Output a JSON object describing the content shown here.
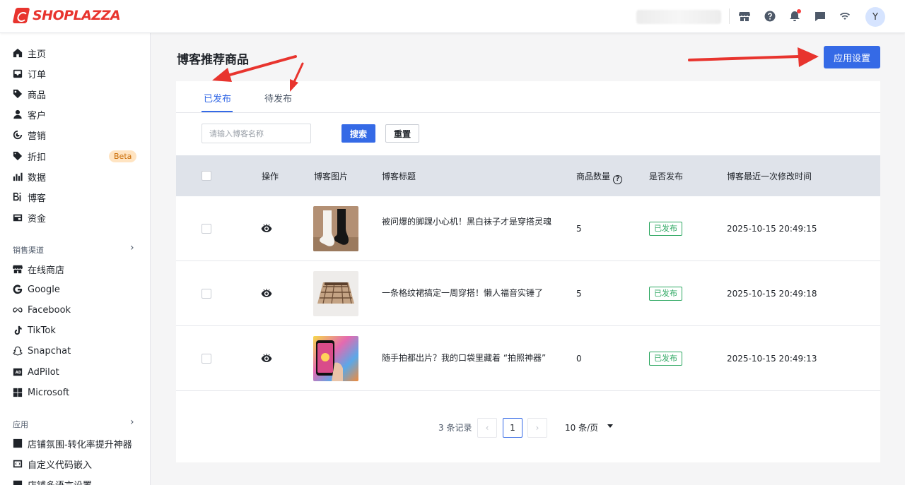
{
  "brand": {
    "name": "SHOPLAZZA",
    "color": "#e8342e"
  },
  "topbar": {
    "icons": [
      "store-icon",
      "help-icon",
      "bell-icon",
      "message-icon",
      "wifi-icon"
    ],
    "avatar_letter": "Y"
  },
  "sidebar": {
    "items": [
      {
        "label": "主页",
        "icon": "home-icon"
      },
      {
        "label": "订单",
        "icon": "inbox-icon"
      },
      {
        "label": "商品",
        "icon": "tag-icon"
      },
      {
        "label": "客户",
        "icon": "user-icon"
      },
      {
        "label": "营销",
        "icon": "target-icon"
      },
      {
        "label": "折扣",
        "icon": "discount-icon",
        "badge": "Beta"
      },
      {
        "label": "数据",
        "icon": "bar-chart-icon"
      },
      {
        "label": "博客",
        "icon": "blog-icon"
      },
      {
        "label": "资金",
        "icon": "wallet-icon"
      }
    ],
    "sales_channels_title": "销售渠道",
    "channels": [
      {
        "label": "在线商店",
        "icon": "store-icon"
      },
      {
        "label": "Google",
        "icon": "google-icon"
      },
      {
        "label": "Facebook",
        "icon": "meta-icon"
      },
      {
        "label": "TikTok",
        "icon": "tiktok-icon"
      },
      {
        "label": "Snapchat",
        "icon": "snapchat-icon"
      },
      {
        "label": "AdPilot",
        "icon": "adpilot-icon"
      },
      {
        "label": "Microsoft",
        "icon": "microsoft-icon"
      }
    ],
    "apps_title": "应用",
    "apps": [
      {
        "label": "店铺氛围-转化率提升神器",
        "icon": "app-icon"
      },
      {
        "label": "自定义代码嵌入",
        "icon": "code-icon"
      },
      {
        "label": "店铺多语言设置",
        "icon": "language-icon"
      }
    ]
  },
  "main": {
    "title": "博客推荐商品",
    "settings_button": "应用设置",
    "tabs": [
      {
        "label": "已发布",
        "active": true
      },
      {
        "label": "待发布",
        "active": false
      }
    ],
    "search": {
      "placeholder": "请输入博客名称",
      "search_label": "搜索",
      "reset_label": "重置"
    },
    "columns": [
      "操作",
      "博客图片",
      "博客标题",
      "商品数量",
      "是否发布",
      "博客最近一次修改时间"
    ],
    "rows": [
      {
        "title": "被问爆的脚踝小心机！黑白袜子才是穿搭灵魂",
        "count": "5",
        "status": "已发布",
        "modified": "2025-10-15 20:49:15",
        "image": "socks"
      },
      {
        "title": "一条格纹裙搞定一周穿搭！懒人福音实锤了",
        "count": "5",
        "status": "已发布",
        "modified": "2025-10-15 20:49:18",
        "image": "skirt"
      },
      {
        "title": "随手拍都出片？我的口袋里藏着 “拍照神器”",
        "count": "0",
        "status": "已发布",
        "modified": "2025-10-15 20:49:13",
        "image": "phone"
      }
    ],
    "pagination": {
      "total_text": "3 条记录",
      "prev": "‹",
      "current": "1",
      "next": "›",
      "page_size": "10 条/页"
    }
  },
  "colors": {
    "primary": "#356ae6",
    "success": "#2ea862",
    "annotation": "#e8342e"
  }
}
